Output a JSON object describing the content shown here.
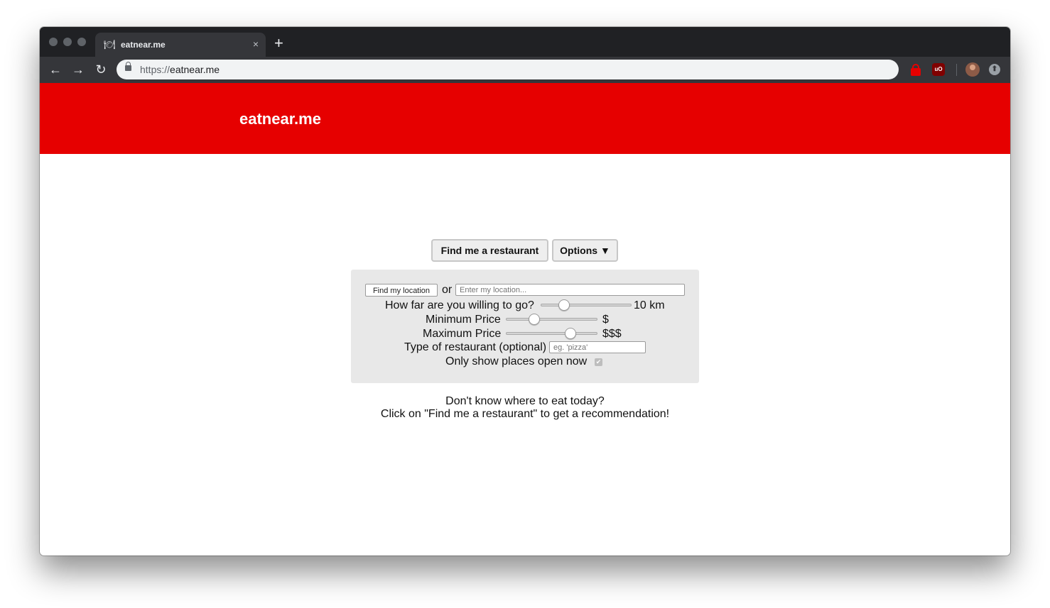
{
  "browser": {
    "tab_title": "eatnear.me",
    "tab_favicon": "plate-cutlery-icon",
    "new_tab_symbol": "+",
    "close_symbol": "×",
    "url_scheme": "https://",
    "url_host": "eatnear.me",
    "nav": {
      "back": "←",
      "forward": "→",
      "reload": "↻"
    },
    "extensions": [
      {
        "icon": "red-lock-extension-icon"
      },
      {
        "icon": "ublock-origin-icon",
        "text": "uO"
      }
    ],
    "update_symbol": "⬆"
  },
  "site": {
    "brand": "eatnear.me",
    "brand_color": "#e60000"
  },
  "actions": {
    "find_label": "Find me a restaurant",
    "options_label": "Options ▼"
  },
  "options": {
    "find_location_label": "Find my location",
    "or_text": "or",
    "location_placeholder": "Enter my location...",
    "distance_label": "How far are you willing to go?",
    "distance_value": "10 km",
    "distance_level": 0.22,
    "min_price_label": "Minimum Price",
    "min_price_value": "$",
    "min_price_level": 0.28,
    "max_price_label": "Maximum Price",
    "max_price_value": "$$$",
    "max_price_level": 0.72,
    "type_label": "Type of restaurant (optional)",
    "type_placeholder": "eg. 'pizza'",
    "open_now_label": "Only show places open now",
    "open_now_checked": true
  },
  "info": {
    "line1": "Don't know where to eat today?",
    "line2": "Click on \"Find me a restaurant\" to get a recommendation!"
  }
}
